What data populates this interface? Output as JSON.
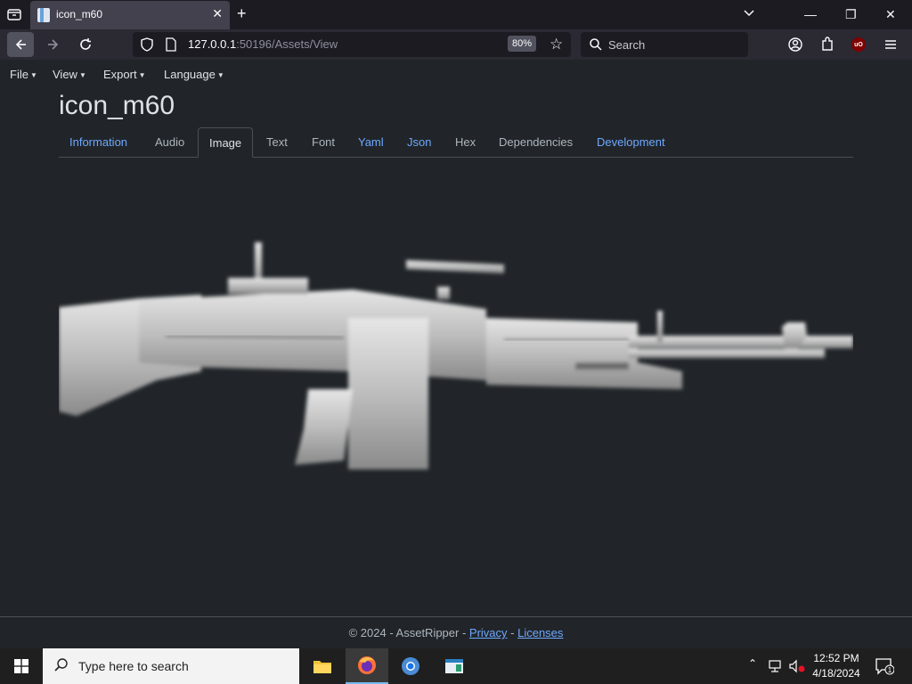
{
  "browser": {
    "tab_title": "icon_m60",
    "url_host": "127.0.0.1",
    "url_rest": ":50196/Assets/View",
    "zoom": "80%",
    "search_placeholder": "Search"
  },
  "menu": {
    "file": "File",
    "view": "View",
    "export": "Export",
    "language": "Language"
  },
  "asset": {
    "title": "icon_m60"
  },
  "tabs": [
    {
      "label": "Information"
    },
    {
      "label": "Audio"
    },
    {
      "label": "Image"
    },
    {
      "label": "Text"
    },
    {
      "label": "Font"
    },
    {
      "label": "Yaml"
    },
    {
      "label": "Json"
    },
    {
      "label": "Hex"
    },
    {
      "label": "Dependencies"
    },
    {
      "label": "Development"
    }
  ],
  "footer": {
    "copyright": "© 2024 - AssetRipper - ",
    "privacy": "Privacy",
    "sep": " - ",
    "licenses": "Licenses"
  },
  "taskbar": {
    "search_placeholder": "Type here to search",
    "time": "12:52 PM",
    "date": "4/18/2024",
    "notif_count": "1"
  },
  "colors": {
    "link": "#6ea8fe",
    "page_bg": "#212529",
    "text": "#dee2e6"
  }
}
